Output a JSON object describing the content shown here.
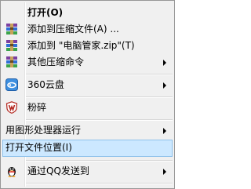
{
  "menu": {
    "items": [
      {
        "label": "打开(O)",
        "bold": true,
        "icon": "",
        "submenu": false
      },
      {
        "label": "添加到压缩文件(A) ...",
        "bold": false,
        "icon": "winrar-archive-icon",
        "submenu": false
      },
      {
        "label": "添加到 \"电脑管家.zip\"(T)",
        "bold": false,
        "icon": "winrar-archive-icon",
        "submenu": false
      },
      {
        "label": "其他压缩命令",
        "bold": false,
        "icon": "winrar-archive-icon",
        "submenu": true
      },
      {
        "label": "360云盘",
        "bold": false,
        "icon": "cloud-drive-icon",
        "submenu": true
      },
      {
        "label": "粉碎",
        "bold": false,
        "icon": "shred-shield-icon",
        "submenu": false
      },
      {
        "label": "用图形处理器运行",
        "bold": false,
        "icon": "",
        "submenu": true
      },
      {
        "label": "打开文件位置(I)",
        "bold": false,
        "icon": "",
        "submenu": false,
        "highlighted": true
      },
      {
        "label": "通过QQ发送到",
        "bold": false,
        "icon": "qq-penguin-icon",
        "submenu": true
      }
    ],
    "highlight_color": "#cce8ff",
    "highlight_border": "#8ec1eb",
    "background": "#f0f0f0"
  }
}
